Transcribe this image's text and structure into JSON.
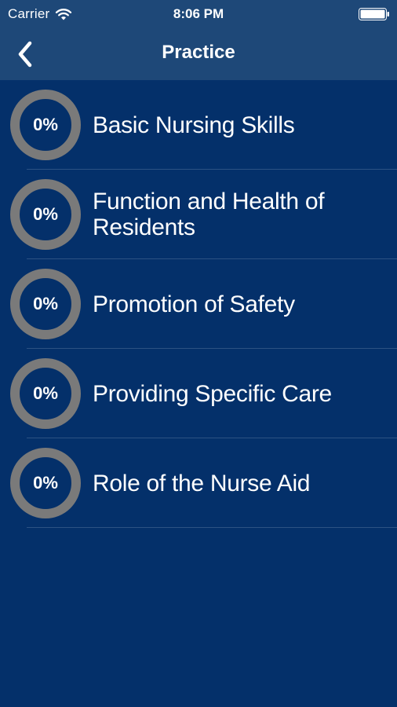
{
  "status_bar": {
    "carrier": "Carrier",
    "time": "8:06 PM",
    "wifi_icon": "wifi-icon",
    "battery_icon": "battery-full-icon"
  },
  "nav": {
    "title": "Practice",
    "back_icon": "chevron-left-icon"
  },
  "colors": {
    "background": "#04306a",
    "header": "#1e4878",
    "ring": "#7a7a7a",
    "separator": "#2c5283",
    "text": "#ffffff"
  },
  "categories": [
    {
      "label": "Basic Nursing Skills",
      "progress": "0%"
    },
    {
      "label": "Function and Health of Residents",
      "progress": "0%"
    },
    {
      "label": "Promotion of Safety",
      "progress": "0%"
    },
    {
      "label": "Providing Specific Care",
      "progress": "0%"
    },
    {
      "label": "Role of the Nurse Aid",
      "progress": "0%"
    }
  ]
}
